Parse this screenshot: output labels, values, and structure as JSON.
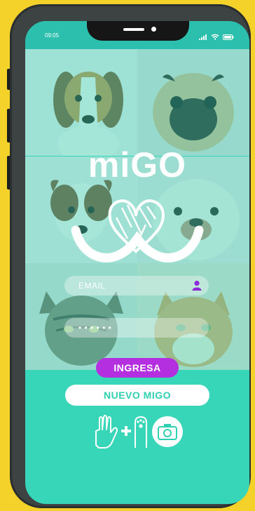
{
  "status": {
    "time": "09:05"
  },
  "app": {
    "logo_text": "miGO"
  },
  "login": {
    "email_placeholder": "EMAIL",
    "password_placeholder": "• • • • • •"
  },
  "buttons": {
    "ingresa_label": "INGRESA",
    "nuevo_label": "NUEVO MIGO"
  },
  "photos": [
    {
      "name": "beagle-puppy-photo",
      "icon": "dog-photo"
    },
    {
      "name": "pug-photo",
      "icon": "dog-photo"
    },
    {
      "name": "terrier-puppy-photo",
      "icon": "dog-photo"
    },
    {
      "name": "bulldog-photo",
      "icon": "dog-photo"
    },
    {
      "name": "tabby-cat-photo",
      "icon": "cat-photo"
    },
    {
      "name": "orange-cat-photo",
      "icon": "cat-photo"
    }
  ],
  "colors": {
    "screen_bg": "#38d6b8",
    "accent_purple": "#b42fe0",
    "phone_body": "#3d4343",
    "page_bg": "#f5d22a"
  }
}
